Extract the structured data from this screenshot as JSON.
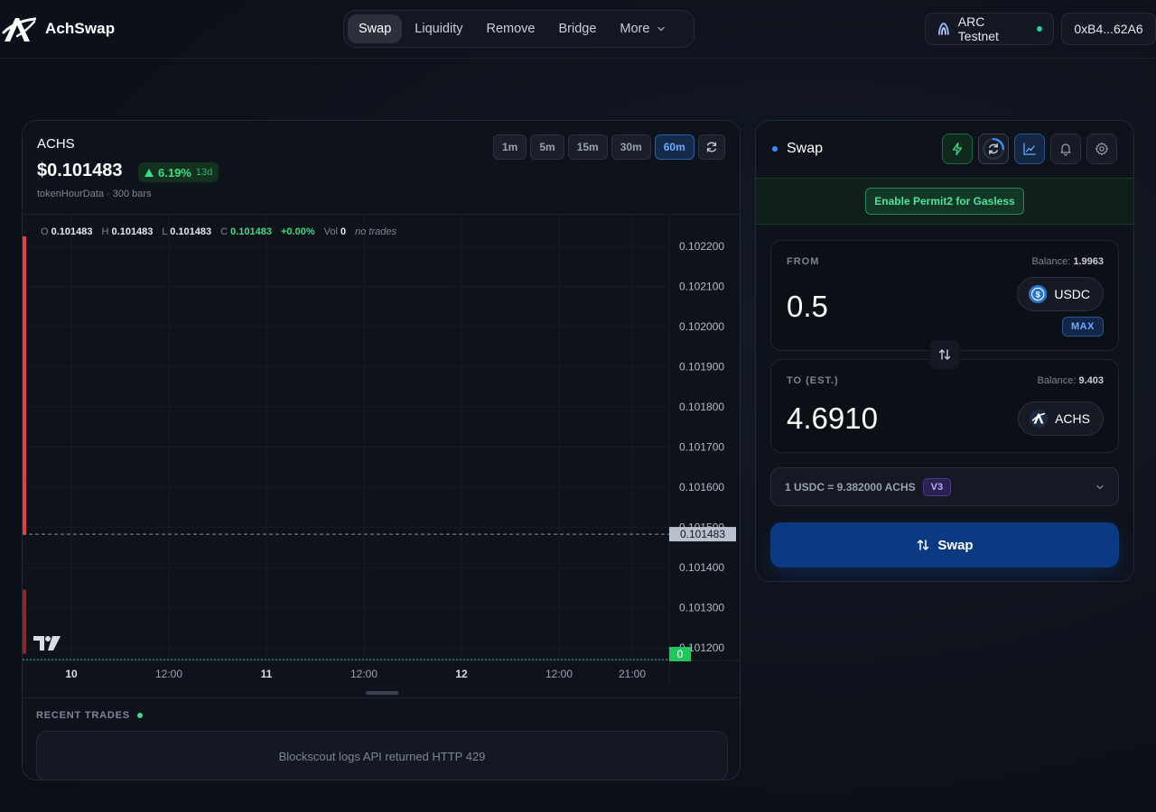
{
  "brand": {
    "name": "AchSwap"
  },
  "nav": {
    "items": [
      {
        "label": "Swap",
        "active": true
      },
      {
        "label": "Liquidity"
      },
      {
        "label": "Remove"
      },
      {
        "label": "Bridge"
      }
    ],
    "more_label": "More"
  },
  "network": {
    "label": "ARC Testnet",
    "status_color": "#2dd29b"
  },
  "wallet": {
    "address": "0xB4...62A6"
  },
  "chart_panel": {
    "symbol": "ACHS",
    "price": "$0.101483",
    "change": "6.19%",
    "change_span": "13d",
    "subtitle": "tokenHourData · 300 bars",
    "timeframes": [
      "1m",
      "5m",
      "15m",
      "30m",
      "60m"
    ],
    "active_timeframe": "60m",
    "ohlc": {
      "o_label": "O",
      "o": "0.101483",
      "h_label": "H",
      "h": "0.101483",
      "l_label": "L",
      "l": "0.101483",
      "c_label": "C",
      "c": "0.101483",
      "change": "+0.00%",
      "vol_label": "Vol",
      "vol": "0",
      "note": "no trades"
    },
    "recent_trades_title": "RECENT TRADES",
    "recent_trades_message": "Blockscout logs API returned HTTP 429"
  },
  "chart_data": {
    "type": "line",
    "y_ticks": [
      "0.102200",
      "0.102100",
      "0.102000",
      "0.101900",
      "0.101800",
      "0.101700",
      "0.101600",
      "0.101500",
      "0.101400",
      "0.101300",
      "0.101200"
    ],
    "ylim": [
      0.10118,
      0.10227
    ],
    "x_ticks": [
      {
        "label": "10",
        "bold": true
      },
      {
        "label": "12:00",
        "bold": false
      },
      {
        "label": "11",
        "bold": true
      },
      {
        "label": "12:00",
        "bold": false
      },
      {
        "label": "12",
        "bold": true
      },
      {
        "label": "12:00",
        "bold": false
      },
      {
        "label": "21:00",
        "bold": false
      }
    ],
    "current_price_label": "0.101483",
    "current_price": 0.101483,
    "volume_label": "0",
    "candles": [
      {
        "open": 0.102225,
        "close": 0.101625,
        "color": "#e53e3e"
      },
      {
        "open": 0.101625,
        "close": 0.101483,
        "color": "#e53e3e"
      },
      {
        "open": 0.101345,
        "close": 0.101185,
        "color": "#8a2828"
      }
    ],
    "colors": {
      "up": "#22c55e",
      "down": "#e53e3e",
      "price_line": "#8b93a3",
      "price_label_bg": "#b9c1cf"
    }
  },
  "swap": {
    "title": "Swap",
    "permit_label": "Enable Permit2 for Gasless",
    "from": {
      "label": "FROM",
      "balance_label": "Balance:",
      "balance": "1.9963",
      "amount": "0.5",
      "token": "USDC",
      "max_label": "MAX"
    },
    "to": {
      "label": "TO (EST.)",
      "balance_label": "Balance:",
      "balance": "9.403",
      "amount": "4.6910",
      "token": "ACHS"
    },
    "rate": "1 USDC = 9.382000 ACHS",
    "rate_badge": "V3",
    "button_label": "Swap"
  }
}
